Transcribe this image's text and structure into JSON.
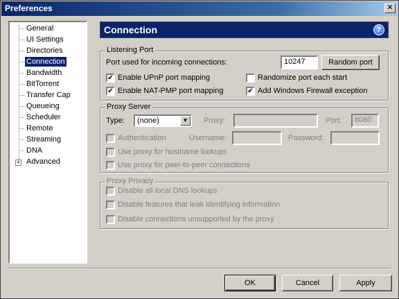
{
  "window": {
    "title": "Preferences",
    "close_glyph": "✕"
  },
  "tree": {
    "items": [
      {
        "label": "General"
      },
      {
        "label": "UI Settings"
      },
      {
        "label": "Directories"
      },
      {
        "label": "Connection",
        "selected": true
      },
      {
        "label": "Bandwidth"
      },
      {
        "label": "BitTorrent"
      },
      {
        "label": "Transfer Cap"
      },
      {
        "label": "Queueing"
      },
      {
        "label": "Scheduler"
      },
      {
        "label": "Remote"
      },
      {
        "label": "Streaming"
      },
      {
        "label": "DNA"
      },
      {
        "label": "Advanced",
        "expandable": true
      }
    ],
    "expander_glyph": "+"
  },
  "header": {
    "title": "Connection",
    "help_glyph": "?"
  },
  "listening_port": {
    "title": "Listening Port",
    "port_label": "Port used for incoming connections:",
    "port_value": "10247",
    "random_port_button": "Random port",
    "upnp": {
      "label": "Enable UPnP port mapping",
      "checked": true
    },
    "natpmp": {
      "label": "Enable NAT-PMP port mapping",
      "checked": true
    },
    "randomize": {
      "label": "Randomize port each start",
      "checked": false
    },
    "firewall": {
      "label": "Add Windows Firewall exception",
      "checked": true
    }
  },
  "proxy_server": {
    "title": "Proxy Server",
    "type_label": "Type:",
    "type_value": "(none)",
    "proxy_label": "Proxy:",
    "proxy_value": "",
    "port_label": "Port:",
    "port_value": "8080",
    "auth": {
      "label": "Authentication",
      "checked": false
    },
    "username_label": "Username:",
    "username_value": "",
    "password_label": "Password:",
    "password_value": "",
    "hostname": {
      "label": "Use proxy for hostname lookups",
      "checked": false
    },
    "p2p": {
      "label": "Use proxy for peer-to-peer connections",
      "checked": false
    }
  },
  "proxy_privacy": {
    "title": "Proxy Privacy",
    "dns": {
      "label": "Disable all local DNS lookups",
      "checked": false
    },
    "leak": {
      "label": "Disable features that leak identifying information",
      "checked": false
    },
    "unsupported": {
      "label": "Disable connections unsupported by the proxy",
      "checked": false
    }
  },
  "buttons": {
    "ok": "OK",
    "cancel": "Cancel",
    "apply": "Apply"
  },
  "check_glyph": "✔",
  "dropdown_glyph": "▼"
}
